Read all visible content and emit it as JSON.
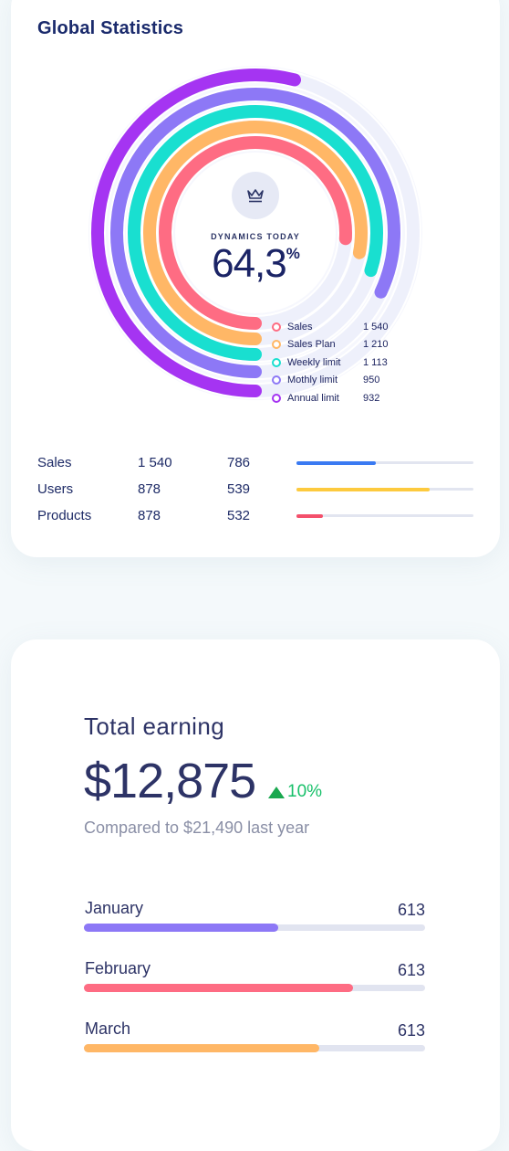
{
  "global": {
    "title": "Global Statistics",
    "dynamics_label": "DYNAMICS TODAY",
    "dynamics_value": "64,3",
    "dynamics_unit": "%",
    "crown_icon": "crown-icon",
    "rings": [
      {
        "name": "Sales",
        "value": "1 540",
        "color": "#fe6c83",
        "fill": 0.76
      },
      {
        "name": "Sales Plan",
        "value": "1 210",
        "color": "#ffb766",
        "fill": 0.78
      },
      {
        "name": "Weekly limit",
        "value": "1 113",
        "color": "#19dfd0",
        "fill": 0.8
      },
      {
        "name": "Mothly limit",
        "value": "950",
        "color": "#8d78f6",
        "fill": 0.82
      },
      {
        "name": "Annual limit",
        "value": "932",
        "color": "#a534f2",
        "fill": 0.54
      }
    ],
    "ring_track_color": "#eef0fb",
    "stats": [
      {
        "name": "Sales",
        "a": "1 540",
        "b": "786",
        "progress": 0.45,
        "color": "#3a7af2"
      },
      {
        "name": "Users",
        "a": "878",
        "b": "539",
        "progress": 0.75,
        "color": "#fdca3e"
      },
      {
        "name": "Products",
        "a": "878",
        "b": "532",
        "progress": 0.15,
        "color": "#f4506b"
      }
    ]
  },
  "earning": {
    "title": "Total earning",
    "amount": "$12,875",
    "change": "10%",
    "change_color": "#18c06a",
    "compare": "Compared to $21,490 last year",
    "months": [
      {
        "name": "January",
        "value": "613",
        "progress": 0.57,
        "color": "#8d78f6"
      },
      {
        "name": "February",
        "value": "613",
        "progress": 0.79,
        "color": "#fe6c83"
      },
      {
        "name": "March",
        "value": "613",
        "progress": 0.69,
        "color": "#ffb766"
      }
    ]
  }
}
